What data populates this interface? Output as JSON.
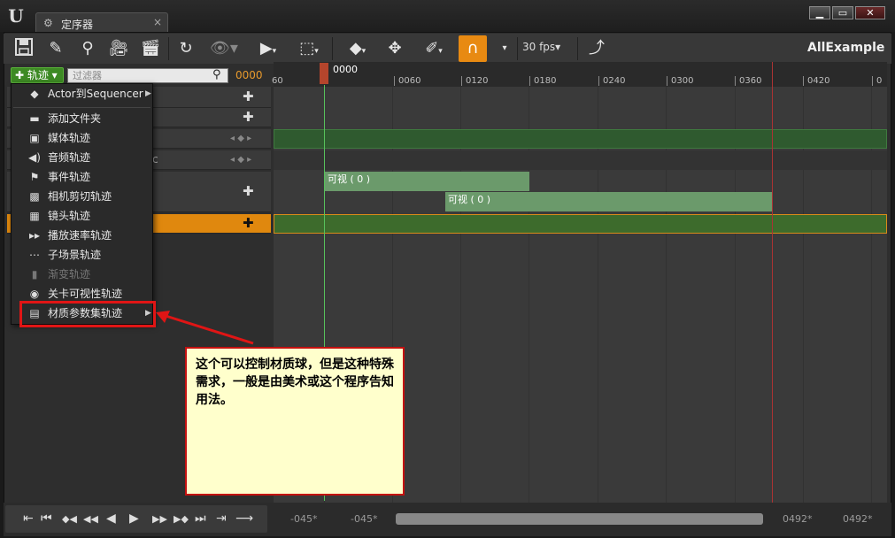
{
  "window": {
    "tab_title": "定序器",
    "tab_icon": "sequencer-icon",
    "close_glyph": "×",
    "buttons": {
      "minimize": "▁",
      "maximize": "▭",
      "close": "✕"
    }
  },
  "toolbar": {
    "icons": [
      "save-icon",
      "save-as-icon",
      "search-icon",
      "camera-icon",
      "clapper-icon",
      "refresh-icon",
      "eye-icon",
      "play-icon",
      "select-icon",
      "keyframe-icon",
      "keyframe-nav-icon",
      "pencil-icon",
      "magnet-icon",
      "curve-icon"
    ],
    "fps": "30 fps▾",
    "project_name": "AllExample"
  },
  "filter": {
    "add_track_label": "✚ 轨迹 ▾",
    "placeholder": "过滤器",
    "frame": "0000"
  },
  "menu": {
    "items": [
      {
        "icon": "actor-icon",
        "label": "Actor到Sequencer",
        "submenu": true,
        "disabled": false
      },
      {
        "icon": "folder-icon",
        "label": "添加文件夹",
        "submenu": false,
        "disabled": false
      },
      {
        "icon": "tv-icon",
        "label": "媒体轨迹",
        "submenu": false,
        "disabled": false
      },
      {
        "icon": "speaker-icon",
        "label": "音频轨迹",
        "submenu": false,
        "disabled": false
      },
      {
        "icon": "flag-icon",
        "label": "事件轨迹",
        "submenu": false,
        "disabled": false
      },
      {
        "icon": "camera-cut-icon",
        "label": "相机剪切轨迹",
        "submenu": false,
        "disabled": false
      },
      {
        "icon": "film-icon",
        "label": "镜头轨迹",
        "submenu": false,
        "disabled": false
      },
      {
        "icon": "play-rate-icon",
        "label": "播放速率轨迹",
        "submenu": false,
        "disabled": false
      },
      {
        "icon": "subscene-icon",
        "label": "子场景轨迹",
        "submenu": false,
        "disabled": false
      },
      {
        "icon": "fade-icon",
        "label": "渐变轨迹",
        "submenu": false,
        "disabled": true
      },
      {
        "icon": "eye-icon",
        "label": "关卡可视性轨迹",
        "submenu": false,
        "disabled": false
      },
      {
        "icon": "material-collection-icon",
        "label": "材质参数集轨迹",
        "submenu": true,
        "disabled": false
      }
    ]
  },
  "left_rows": {
    "keys_glyph": "◂ ◆ ▸",
    "plus_glyph": "✚",
    "partial_glyph": "c"
  },
  "timeline": {
    "current_frame": "0000",
    "ticks": [
      "60",
      "0060",
      "0120",
      "0180",
      "0240",
      "0300",
      "0360",
      "0420",
      "0"
    ],
    "sections": [
      {
        "label": "可视 ( 0 )"
      },
      {
        "label": "可视 ( 0 )"
      }
    ]
  },
  "callout": {
    "text": "这个可以控制材质球，但是这种特殊需求，一般是由美术或这个程序告知用法。"
  },
  "bottom": {
    "transport": [
      "⇤",
      "⏮",
      "◆◀",
      "◀◀",
      "◀",
      "▶",
      "▶▶",
      "▶◆",
      "⏭",
      "⇥",
      "⟶"
    ],
    "range_start_1": "-045*",
    "range_start_2": "-045*",
    "range_end_1": "0492*",
    "range_end_2": "0492*"
  },
  "colors": {
    "accent": "#e88a12",
    "track_green": "#2f5a2f",
    "section_green": "#6b9a6b",
    "callout_bg": "#ffffcc",
    "highlight_red": "#e01515"
  }
}
